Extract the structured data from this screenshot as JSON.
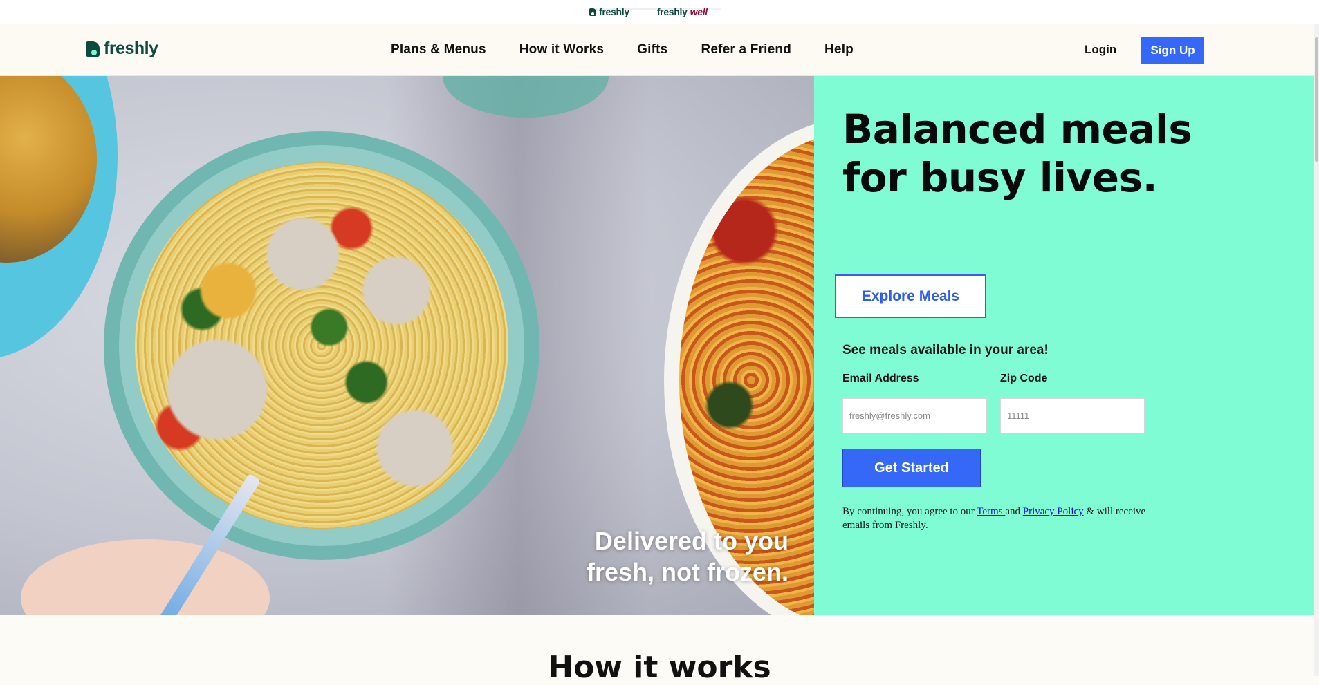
{
  "brand_bar": {
    "tabs": [
      {
        "label": "freshly",
        "suffix": ""
      },
      {
        "label": "freshly",
        "suffix": "well"
      }
    ]
  },
  "nav": {
    "logo_text": "freshly",
    "menu": [
      "Plans & Menus",
      "How it Works",
      "Gifts",
      "Refer a Friend",
      "Help"
    ],
    "login": "Login",
    "signup": "Sign Up"
  },
  "hero": {
    "tagline_line1": "Delivered to you",
    "tagline_line2": "fresh, not frozen.",
    "headline": "Balanced meals for busy lives.",
    "explore_button": "Explore Meals",
    "area_prompt": "See meals available in your area!",
    "email_label": "Email Address",
    "email_placeholder": "freshly@freshly.com",
    "zip_label": "Zip Code",
    "zip_placeholder": "11111",
    "get_started": "Get Started",
    "legal_prefix": "By continuing, you agree to our ",
    "terms_link": "Terms ",
    "legal_and": "and ",
    "privacy_link": "Privacy Policy",
    "legal_suffix": " & will receive emails from Freshly."
  },
  "how_it_works": {
    "title": "How it works"
  },
  "colors": {
    "accent_blue": "#3568f7",
    "panel_mint": "#7ffcd4",
    "logo_green": "#0c4a3f"
  }
}
